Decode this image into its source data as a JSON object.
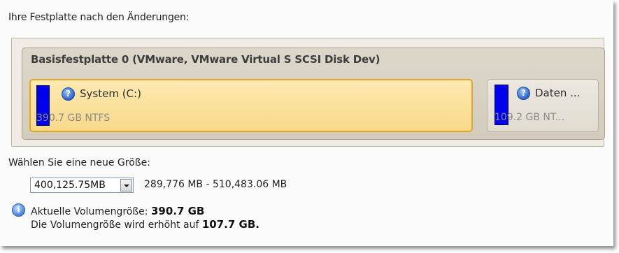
{
  "header": {
    "label": "Ihre Festplatte nach den Änderungen:"
  },
  "disk": {
    "title": "Basisfestplatte 0 (VMware, VMware Virtual S SCSI Disk Dev)",
    "partitions": [
      {
        "name": "System (C:)",
        "info": "390.7 GB NTFS",
        "selected": true,
        "bar_color": "#0000ee"
      },
      {
        "name": "Daten ...",
        "info": "109.2 GB NT...",
        "selected": false,
        "bar_color": "#0000ee"
      }
    ]
  },
  "resize": {
    "label": "Wählen Sie eine neue Größe:",
    "value": "400,125.75MB",
    "range": "289,776 MB - 510,483.06 MB"
  },
  "info": {
    "current_label": "Aktuelle Volumengröße:",
    "current_value": "390.7 GB",
    "increase_label": "Die Volumengröße wird erhöht auf",
    "increase_value": "107.7 GB."
  },
  "icons": {
    "help": "question-icon",
    "info": "info-icon",
    "dropdown": "chevron-down-icon"
  },
  "colors": {
    "selected_border": "#e4a628",
    "partition_bar": "#0000ee"
  }
}
